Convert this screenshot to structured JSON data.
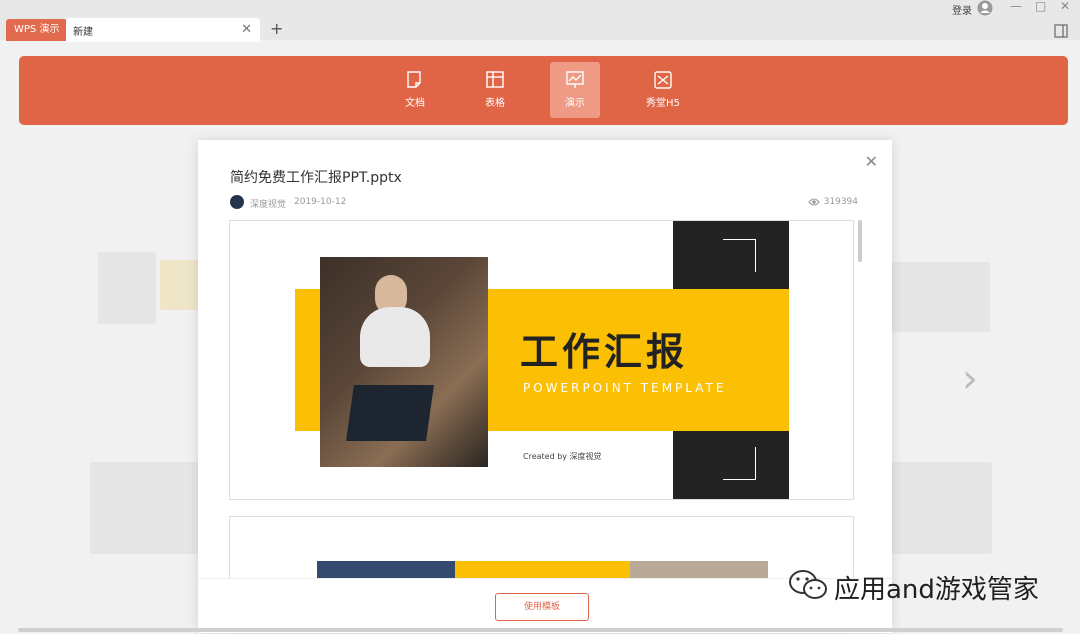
{
  "app": {
    "app_tab_label": "WPS 演示",
    "new_tab_label": "新建",
    "login_label": "登录"
  },
  "nav": {
    "items": [
      {
        "label": "文档",
        "icon": "document-icon"
      },
      {
        "label": "表格",
        "icon": "spreadsheet-icon"
      },
      {
        "label": "演示",
        "icon": "presentation-icon",
        "active": true
      },
      {
        "label": "秀堂H5",
        "icon": "h5-icon"
      }
    ]
  },
  "modal": {
    "title": "简约免费工作汇报PPT.pptx",
    "author": "深度视觉",
    "date": "2019-10-12",
    "views": "319394",
    "use_button_label": "使用模板"
  },
  "slide": {
    "main_title": "工作汇报",
    "subtitle": "POWERPOINT TEMPLATE",
    "created_by": "Created by 深度视觉"
  },
  "watermark": {
    "text": "应用and游戏管家"
  },
  "colors": {
    "accent": "#e06547",
    "slide_yellow": "#fbbf04",
    "slide_dark": "#232323"
  }
}
